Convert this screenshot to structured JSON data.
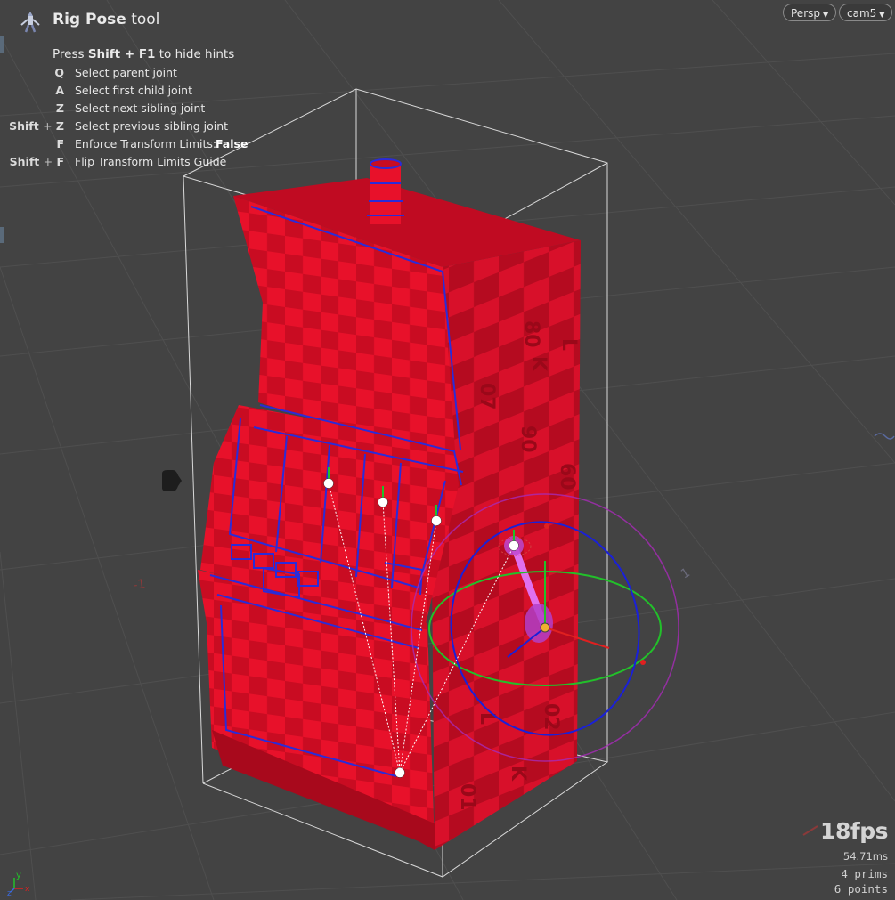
{
  "tool": {
    "name_bold": "Rig Pose",
    "name_rest": " tool",
    "icon": "rig-pose-icon"
  },
  "hints": {
    "intro_pre": "Press ",
    "intro_key": "Shift + F1",
    "intro_post": " to hide hints",
    "rows": [
      {
        "mod": "",
        "key": "Q",
        "desc": "Select parent joint",
        "value": ""
      },
      {
        "mod": "",
        "key": "A",
        "desc": "Select first child joint",
        "value": ""
      },
      {
        "mod": "",
        "key": "Z",
        "desc": "Select next sibling joint",
        "value": ""
      },
      {
        "mod": "Shift",
        "key": "Z",
        "desc": "Select previous sibling joint",
        "value": ""
      },
      {
        "mod": "",
        "key": "F",
        "desc": "Enforce Transform Limits:",
        "value": "False"
      },
      {
        "mod": "Shift",
        "key": "F",
        "desc": "Flip Transform Limits Guide",
        "value": ""
      }
    ],
    "plus": "+"
  },
  "view_menu": {
    "label": "Persp"
  },
  "camera_menu": {
    "label": "cam5"
  },
  "stats": {
    "fps": "18fps",
    "ms": "54.71ms",
    "prims": "4  prims",
    "points": "6 points"
  },
  "axes": {
    "y": "y",
    "z": "z",
    "x": "x"
  },
  "scene_labels": {
    "grid_left": "-1",
    "grid_right": "1"
  },
  "colors": {
    "background": "#434343",
    "grid": "#505050",
    "model_red": "#e8112a",
    "joint_blue": "#2b2bd8",
    "ring_green": "#22c02a",
    "ring_blue": "#1a20d8",
    "ring_magenta": "#a82ab8",
    "joint_white": "#ffffff"
  }
}
